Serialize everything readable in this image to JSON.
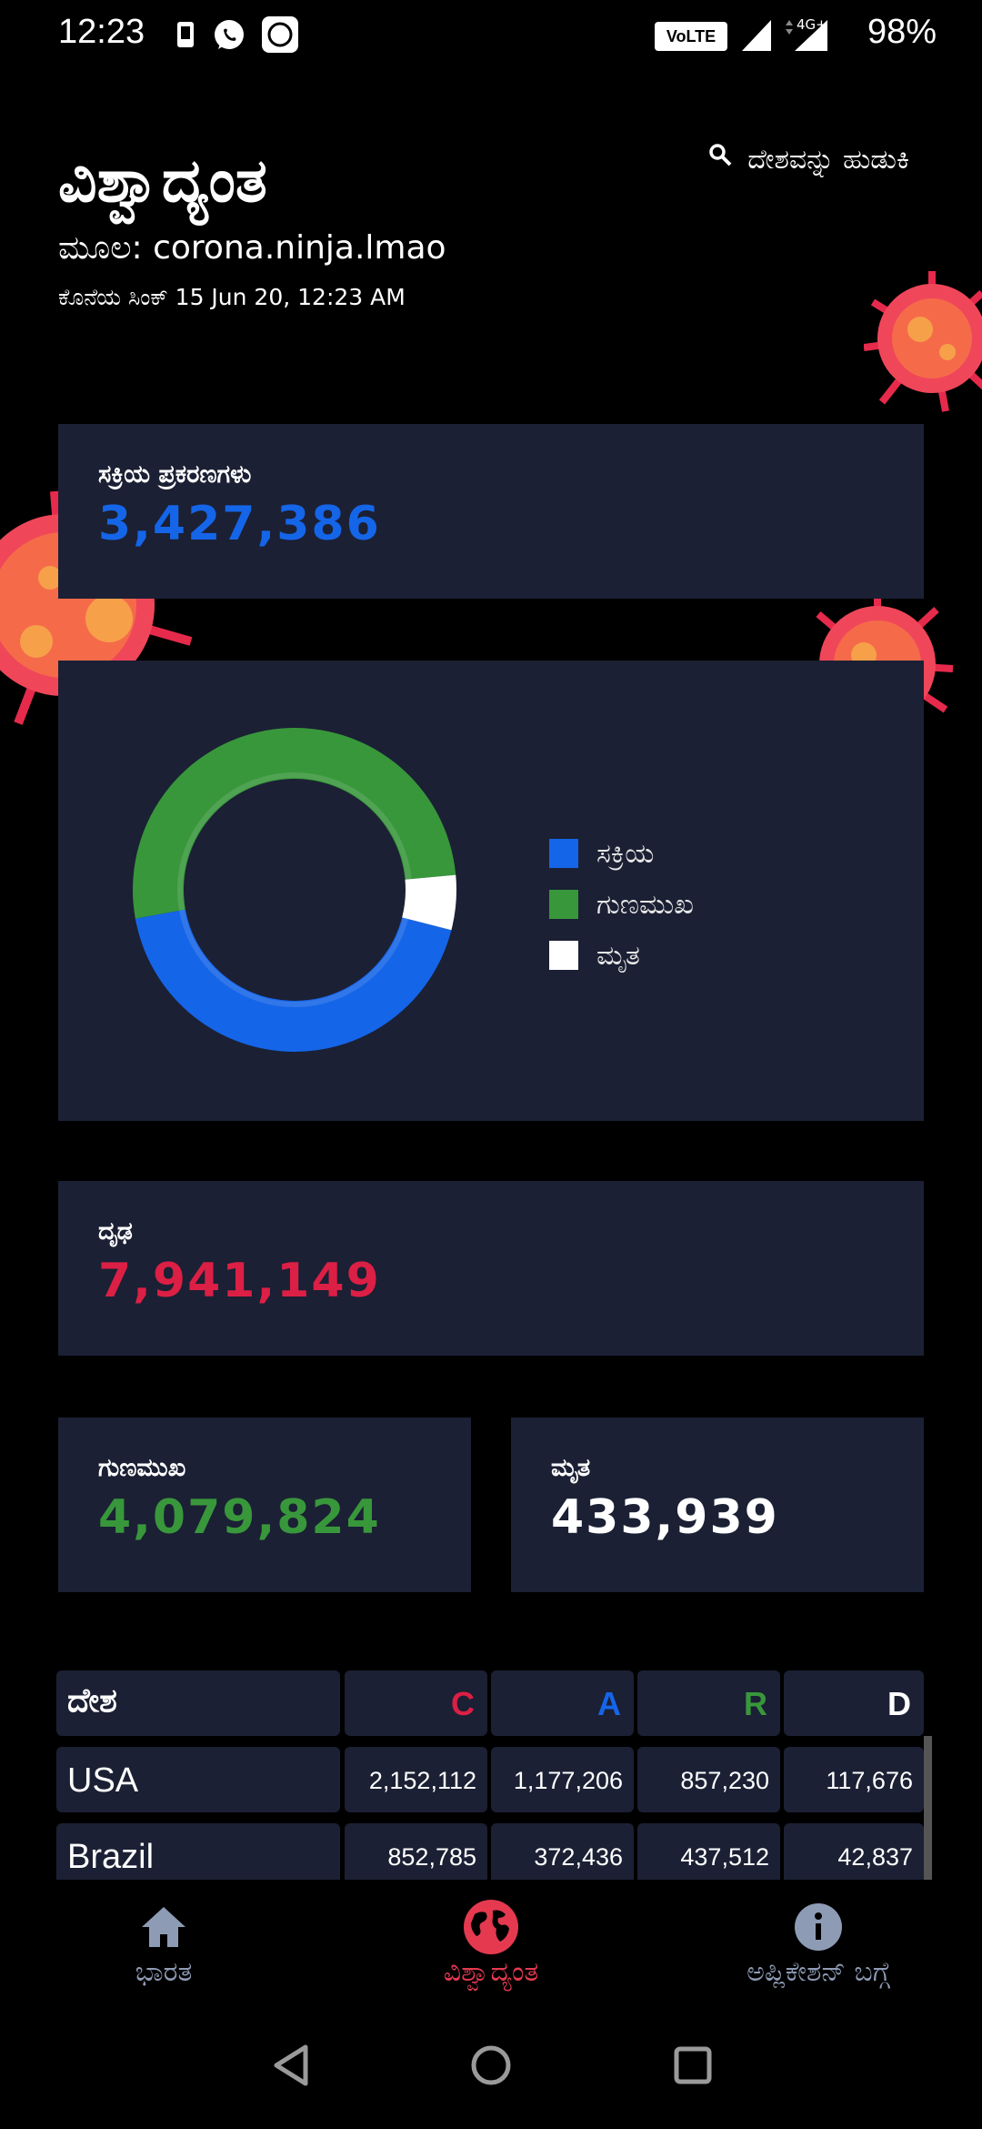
{
  "status_bar": {
    "time": "12:23",
    "network": "VoLTE",
    "signal2_label": "4G+",
    "battery": "98%",
    "icons": [
      "phone-icon",
      "whatsapp-icon",
      "mi-icon",
      "volte-icon",
      "signal-icon",
      "signal-4g-icon"
    ]
  },
  "header": {
    "title": "ವಿಶ್ವಾದ್ಯಂತ",
    "source": "ಮೂಲ: corona.ninja.lmao",
    "last_sync": "ಕೊನೆಯ ಸಿಂಕ್ 15 Jun 20, 12:23 AM",
    "search_label": "ದೇಶವನ್ನು ಹುಡುಕಿ"
  },
  "active_card": {
    "label": "ಸಕ್ರಿಯ ಪ್ರಕರಣಗಳು",
    "value": "3,427,386",
    "color": "#1565e8"
  },
  "chart_data": {
    "type": "pie",
    "style": "donut",
    "categories": [
      "ಸಕ್ರಿಯ",
      "ಗುಣಮುಖ",
      "ಮೃತ"
    ],
    "values": [
      3427386,
      4079824,
      433939
    ],
    "colors": [
      "#1565e8",
      "#38973b",
      "#ffffff"
    ],
    "legend_position": "right"
  },
  "confirmed_card": {
    "label": "ದೃಢ",
    "value": "7,941,149",
    "color": "#dc1f45"
  },
  "recovered_card": {
    "label": "ಗುಣಮುಖ",
    "value": "4,079,824",
    "color": "#38973b"
  },
  "deaths_card": {
    "label": "ಮೃತ",
    "value": "433,939",
    "color": "#ffffff"
  },
  "table": {
    "headers": [
      {
        "text": "ದೇಶ",
        "color": "#ffffff"
      },
      {
        "text": "C",
        "color": "#dc1f45"
      },
      {
        "text": "A",
        "color": "#1565e8"
      },
      {
        "text": "R",
        "color": "#38973b"
      },
      {
        "text": "D",
        "color": "#ffffff"
      }
    ],
    "rows": [
      {
        "country": "USA",
        "c": "2,152,112",
        "a": "1,177,206",
        "r": "857,230",
        "d": "117,676"
      },
      {
        "country": "Brazil",
        "c": "852,785",
        "a": "372,436",
        "r": "437,512",
        "d": "42,837"
      }
    ]
  },
  "bottom_nav": {
    "items": [
      {
        "label": "ಭಾರತ",
        "icon": "home-icon",
        "active": false
      },
      {
        "label": "ವಿಶ್ವಾದ್ಯಂತ",
        "icon": "globe-icon",
        "active": true
      },
      {
        "label": "ಅಪ್ಲಿಕೇಶನ್ ಬಗ್ಗೆ",
        "icon": "info-icon",
        "active": false
      }
    ],
    "active_color": "#e53950",
    "inactive_color": "#8e9bb5"
  }
}
